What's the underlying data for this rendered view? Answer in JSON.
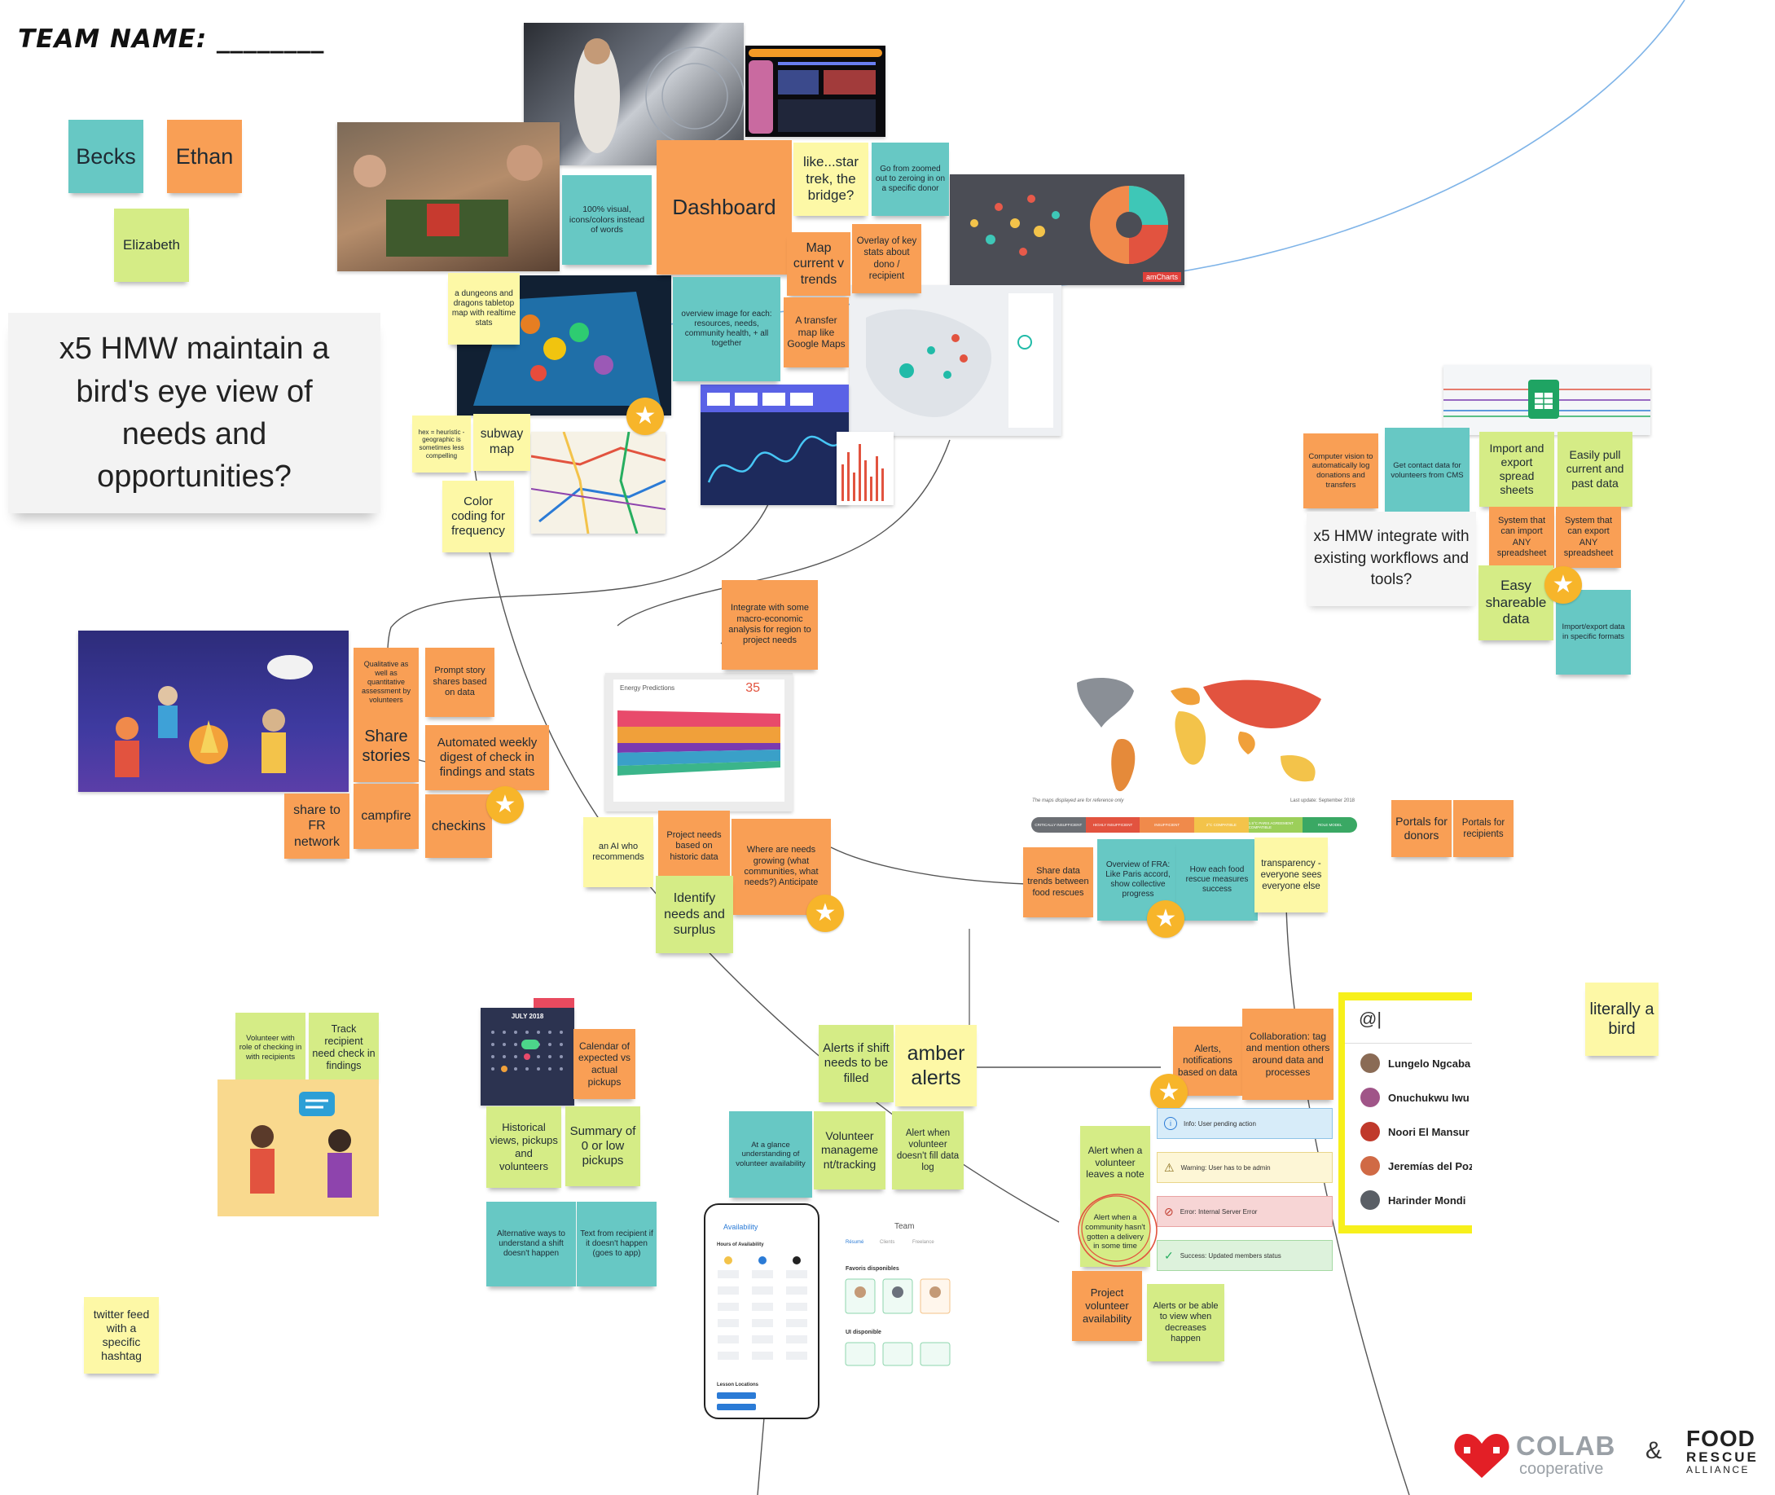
{
  "header": {
    "team_label": "TEAM NAME: ________"
  },
  "team": {
    "member_1": "Becks",
    "member_2": "Ethan",
    "member_3": "Elizabeth"
  },
  "hmw_cards": {
    "birds_eye": "x5 HMW maintain a bird's eye view of needs and opportunities?",
    "integrate": "x5 HMW integrate with existing workflows and tools?"
  },
  "notes": {
    "dnd_map": "a dungeons and dragons tabletop map with realtime stats",
    "visual_icons": "100% visual, icons/colors instead of words",
    "dashboard": "Dashboard",
    "star_trek": "like...star trek, the bridge?",
    "zoom_donor": "Go from zoomed out to zeroing in on a specific donor",
    "map_trends": "Map current v trends",
    "overlay_stats": "Overlay of key stats about dono / recipient",
    "overview_image": "overview image for each: resources, needs, community health, + all together",
    "transfer_map": "A transfer map like Google Maps",
    "hex_heuristic": "hex = heuristic - geographic is sometimes less compelling",
    "subway_map": "subway map",
    "color_coding": "Color coding for frequency",
    "qualitative": "Qualitative as well as quantitative assessment by volunteers",
    "prompt_story": "Prompt story shares based on data",
    "share_stories": "Share stories",
    "weekly_digest": "Automated weekly digest of check in findings and stats",
    "share_fr": "share to FR network",
    "campfire": "campfire",
    "checkins": "checkins",
    "macro_economic": "Integrate with some macro-economic analysis for region to project needs",
    "ai_recommends": "an AI who recommends",
    "project_needs": "Project needs based on historic data",
    "needs_growing": "Where are needs growing (what communities, what needs?) Anticipate",
    "identify_needs": "Identify needs and surplus",
    "computer_vision": "Computer vision to automatically log donations and transfers",
    "contact_data": "Get contact data for volunteers from CMS",
    "import_export": "Import and export spread sheets",
    "easily_pull": "Easily pull current and past data",
    "system_import": "System that can import ANY spreadsheet",
    "system_export": "System that can export ANY spreadsheet",
    "easy_share": "Easy shareable data",
    "import_formats": "Import/export data in specific formats",
    "share_trends": "Share data trends between food rescues",
    "overview_fra": "Overview of FRA: Like Paris accord, show collective progress",
    "rescue_measures": "How each food rescue measures success",
    "transparency": "transparency - everyone sees everyone else",
    "portals_donors": "Portals for donors",
    "portals_recipients": "Portals for recipients",
    "volunteer_role": "Volunteer with role of checking in with recipients",
    "track_recipient": "Track recipient need check in findings",
    "calendar_expected": "Calendar of expected vs actual pickups",
    "historical_views": "Historical views, pickups and volunteers",
    "summary_low": "Summary of 0 or low pickups",
    "alt_ways": "Alternative ways to understand a shift doesn't happen",
    "text_recipient": "Text from recipient if it doesn't happen (goes to app)",
    "alerts_shift": "Alerts if shift needs to be filled",
    "amber_alerts": "amber alerts",
    "glance_availability": "At a glance understanding of volunteer availability",
    "volunteer_mgmt": "Volunteer manageme nt/tracking",
    "alert_data_log": "Alert when volunteer doesn't fill data log",
    "alerts_notifications": "Alerts, notifications based on data",
    "collaboration": "Collaboration: tag and mention others around data and processes",
    "alert_leaves": "Alert when a volunteer leaves a note",
    "alert_community": "Alert when a community hasn't gotten a delivery in some time",
    "project_availability": "Project volunteer availability",
    "alerts_decreases": "Alerts or be able to view when decreases happen",
    "literally_bird": "literally a bird",
    "twitter_feed": "twitter feed with a specific hashtag"
  },
  "screens": {
    "chart_title": "Energy Predictions",
    "chart_value": "35",
    "map_note": "The maps displayed are for reference only",
    "map_date": "Last update: September 2018",
    "ipc_legend": [
      "CRITICALLY INSUFFICIENT",
      "HIGHLY INSUFFICIENT",
      "INSUFFICIENT",
      "2°C COMPATIBLE",
      "1.5°C PARIS AGREEMENT COMPATIBLE",
      "ROLE MODEL"
    ],
    "calendar_month": "JULY 2018",
    "amcharts_label": "amCharts",
    "phone_title": "Availability",
    "phone_section": "Hours of Availability",
    "phone_locations": "Lesson Locations",
    "team_title": "Team",
    "team_tabs": [
      "Résumé",
      "Clients",
      "Freelance"
    ],
    "team_favoris": "Favoris disponibles",
    "team_ui": "UI disponible",
    "mention_input": "@|",
    "mentions": [
      "Lungelo Ngcaba",
      "Onuchukwu Iwu",
      "Noori El Mansur",
      "Jeremías del Pozo",
      "Harinder Mondi"
    ],
    "alert_messages": [
      "Info: User pending action",
      "Warning: User has to be admin",
      "Error: Internal Server Error",
      "Success: Updated members status"
    ]
  },
  "footer": {
    "colab_name": "COLAB",
    "colab_sub": "cooperative",
    "ampersand": "&",
    "food_name": "FOOD",
    "rescue_name": "RESCUE",
    "alliance_name": "ALLIANCE"
  },
  "colors": {
    "teal": "#67c8c4",
    "orange": "#f99f55",
    "yellow": "#fdf8a6",
    "lime": "#d5ec86",
    "star": "#f7b52a",
    "colab_red": "#e31f26"
  }
}
